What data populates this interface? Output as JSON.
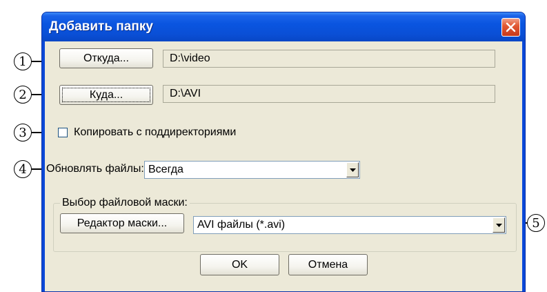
{
  "window": {
    "title": "Добавить папку"
  },
  "source": {
    "button_label": "Откуда...",
    "path": "D:\\video"
  },
  "dest": {
    "button_label": "Куда...",
    "path": "D:\\AVI"
  },
  "copy_subdirs": {
    "label": "Копировать с поддиректориями",
    "checked": false
  },
  "update_files": {
    "label": "Обновлять файлы:",
    "value": "Всегда"
  },
  "mask_group": {
    "legend": "Выбор файловой маски:",
    "editor_button": "Редактор маски...",
    "mask_value": "AVI файлы (*.avi)"
  },
  "buttons": {
    "ok": "OK",
    "cancel": "Отмена"
  },
  "callouts": [
    "1",
    "2",
    "3",
    "4",
    "5"
  ],
  "icons": {
    "close": "close-icon",
    "dropdown": "chevron-down-icon"
  },
  "colors": {
    "title_bar": "#0a55e0",
    "client_bg": "#ece9d8",
    "close_button": "#e25a35"
  }
}
